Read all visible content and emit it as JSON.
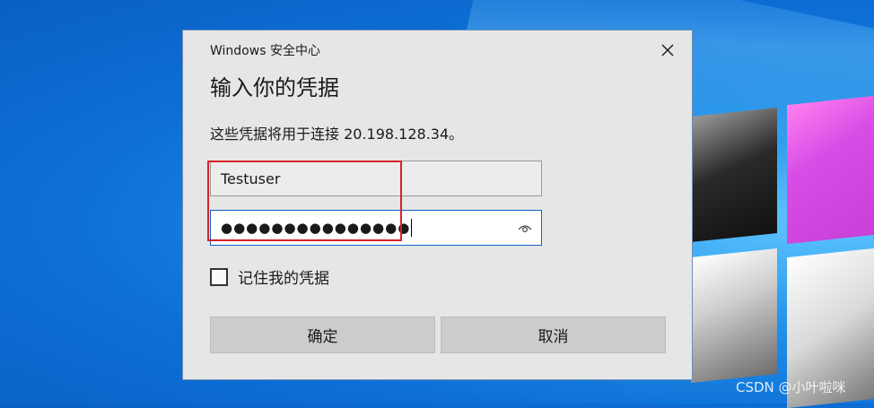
{
  "dialog": {
    "window_title": "Windows 安全中心",
    "heading": "输入你的凭据",
    "description": "这些凭据将用于连接 20.198.128.34。",
    "username_value": "Testuser",
    "password_mask": "●●●●●●●●●●●●●●●",
    "remember_label": "记住我的凭据",
    "remember_checked": false,
    "ok_label": "确定",
    "cancel_label": "取消",
    "close_icon": "close-icon",
    "reveal_icon": "eye-icon"
  },
  "watermark": "CSDN @小叶啦咪",
  "colors": {
    "focus_border": "#0a64c8",
    "highlight_box": "#d4232b",
    "dialog_bg": "#e6e6e6",
    "button_bg": "#cccccc"
  }
}
